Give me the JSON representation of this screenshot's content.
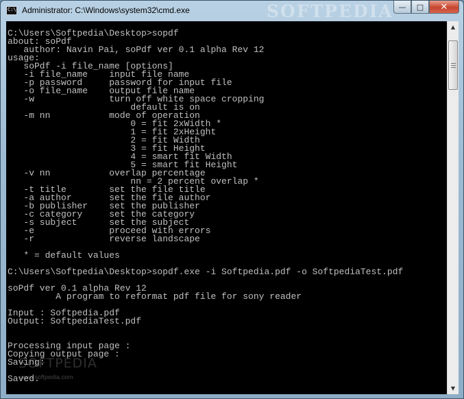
{
  "window": {
    "title": "Administrator: C:\\Windows\\system32\\cmd.exe",
    "icon_label": "C:\\",
    "watermark": "SOFTPEDIA",
    "accent_close_color": "#c7452e",
    "buttons": {
      "minimize_glyph": "—",
      "maximize_glyph": "□",
      "close_glyph": "✕"
    }
  },
  "console": {
    "text_color": "#c0c0c0",
    "background": "#000000",
    "lines": [
      "C:\\Users\\Softpedia\\Desktop>sopdf",
      "about: soPdf",
      "   author: Navin Pai, soPdf ver 0.1 alpha Rev 12",
      "usage:",
      "   soPdf -i file_name [options]",
      "   -i file_name    input file name",
      "   -p password     password for input file",
      "   -o file_name    output file name",
      "   -w              turn off white space cropping",
      "                       default is on",
      "   -m nn           mode of operation",
      "                       0 = fit 2xWidth *",
      "                       1 = fit 2xHeight",
      "                       2 = fit Width",
      "                       3 = fit Height",
      "                       4 = smart fit Width",
      "                       5 = smart fit Height",
      "   -v nn           overlap percentage",
      "                       nn = 2 percent overlap *",
      "   -t title        set the file title",
      "   -a author       set the file author",
      "   -b publisher    set the publisher",
      "   -c category     set the category",
      "   -s subject      set the subject",
      "   -e              proceed with errors",
      "   -r              reverse landscape",
      "",
      "   * = default values",
      "",
      "C:\\Users\\Softpedia\\Desktop>sopdf.exe -i Softpedia.pdf -o SoftpediaTest.pdf",
      "",
      "soPdf ver 0.1 alpha Rev 12",
      "         A program to reformat pdf file for sony reader",
      "",
      "Input : Softpedia.pdf",
      "Output: SoftpediaTest.pdf",
      "",
      "",
      "Processing input page :",
      "Copying output page :",
      "Saving:",
      "",
      "Saved."
    ],
    "watermark_large": "SOFTPEDIA",
    "watermark_small": "www.softpedia.com"
  },
  "scrollbar": {
    "up_glyph": "▲",
    "down_glyph": "▼"
  }
}
